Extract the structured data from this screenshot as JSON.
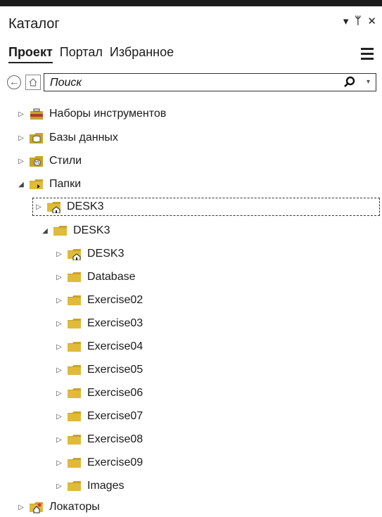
{
  "window": {
    "title": "Каталог",
    "controls": [
      "▾",
      "ᛘ",
      "✕"
    ]
  },
  "tabs": [
    {
      "label": "Проект",
      "active": true
    },
    {
      "label": "Портал",
      "active": false
    },
    {
      "label": "Избранное",
      "active": false
    }
  ],
  "search": {
    "placeholder": "Поиск"
  },
  "tree": {
    "toolboxes": "Наборы инструментов",
    "databases": "Базы данных",
    "styles": "Стили",
    "folders": "Папки",
    "desk3_connection": "DESK3",
    "desk3_folder": "DESK3",
    "children": [
      "DESK3",
      "Database",
      "Exercise02",
      "Exercise03",
      "Exercise04",
      "Exercise05",
      "Exercise06",
      "Exercise07",
      "Exercise08",
      "Exercise09",
      "Images"
    ],
    "locators": "Локаторы"
  },
  "colors": {
    "folder": "#c9a227",
    "toolbox": "#b3392b"
  }
}
